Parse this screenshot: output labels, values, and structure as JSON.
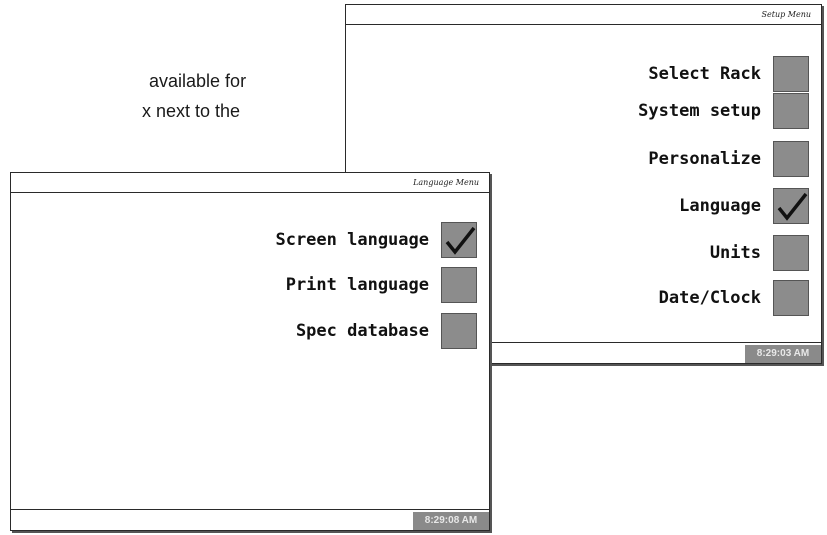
{
  "document": {
    "line1": "available for",
    "line2": "x next to the"
  },
  "setup_screen": {
    "title": "Setup Menu",
    "items": [
      {
        "label": "Select Rack",
        "checked": false
      },
      {
        "label": "System setup",
        "checked": false
      },
      {
        "label": "Personalize",
        "checked": false
      },
      {
        "label": "Language",
        "checked": true
      },
      {
        "label": "Units",
        "checked": false
      },
      {
        "label": "Date/Clock",
        "checked": false
      }
    ],
    "clock": "8:29:03 AM"
  },
  "language_screen": {
    "title": "Language Menu",
    "items": [
      {
        "label": "Screen language",
        "checked": true
      },
      {
        "label": "Print language",
        "checked": false
      },
      {
        "label": "Spec database",
        "checked": false
      }
    ],
    "clock": "8:29:08 AM"
  },
  "colors": {
    "checkbox_fill": "#8c8c8c",
    "clock_bg": "#8a8a8a",
    "border": "#2a2a2a"
  }
}
